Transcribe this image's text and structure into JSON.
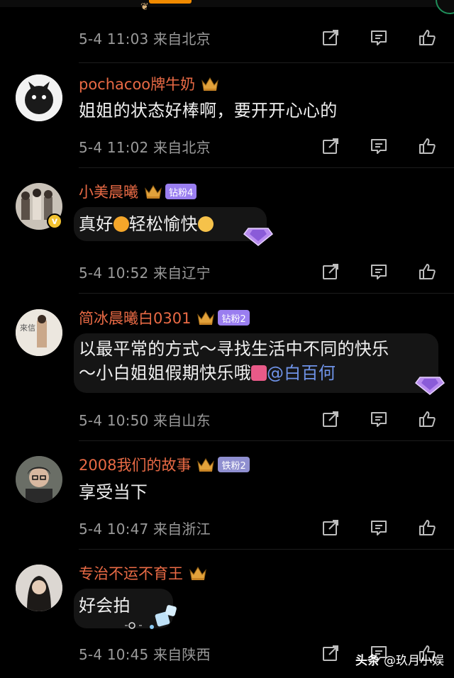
{
  "comments_top": {
    "meta": "5-4 11:03 来自北京"
  },
  "comments": [
    {
      "username": "pochacoo牌牛奶",
      "badge": "",
      "text": "姐姐的状态好棒啊，要开开心心的",
      "meta": "5-4 11:02 来自北京",
      "avatar": "avatar-black-cat"
    },
    {
      "username": "小美晨曦",
      "badge": "钻粉4",
      "text_parts": [
        "真好",
        "轻松愉快"
      ],
      "meta": "5-4 10:52 来自辽宁",
      "avatar": "avatar-group-photo"
    },
    {
      "username": "简冰晨曦白0301",
      "badge": "钻粉2",
      "text_line1": "以最平常的方式～寻找生活中不同的快乐",
      "text_line2": "～小白姐姐假期快乐哦",
      "mention": "@白百何",
      "meta": "5-4 10:50 来自山东",
      "avatar": "avatar-poster"
    },
    {
      "username": "2008我们的故事",
      "badge": "铁粉2",
      "text": "享受当下",
      "meta": "5-4 10:47 来自浙江",
      "avatar": "avatar-woman-glasses"
    },
    {
      "username": "专治不运不育王",
      "badge": "",
      "text": "好会拍",
      "meta": "5-4 10:45 来自陕西",
      "avatar": "avatar-girl"
    }
  ],
  "actions": {
    "share_icon": "share-icon",
    "comment_icon": "comment-icon",
    "like_icon": "like-icon"
  },
  "watermark": {
    "logo": "头条",
    "handle": "@玖月小娱"
  },
  "colors": {
    "background": "#000000",
    "username": "#e96a45",
    "meta": "#9a9a9a",
    "mention": "#6f93e8",
    "badge_diamond": "#9a7ef0",
    "badge_iron": "#8f8fd0"
  }
}
